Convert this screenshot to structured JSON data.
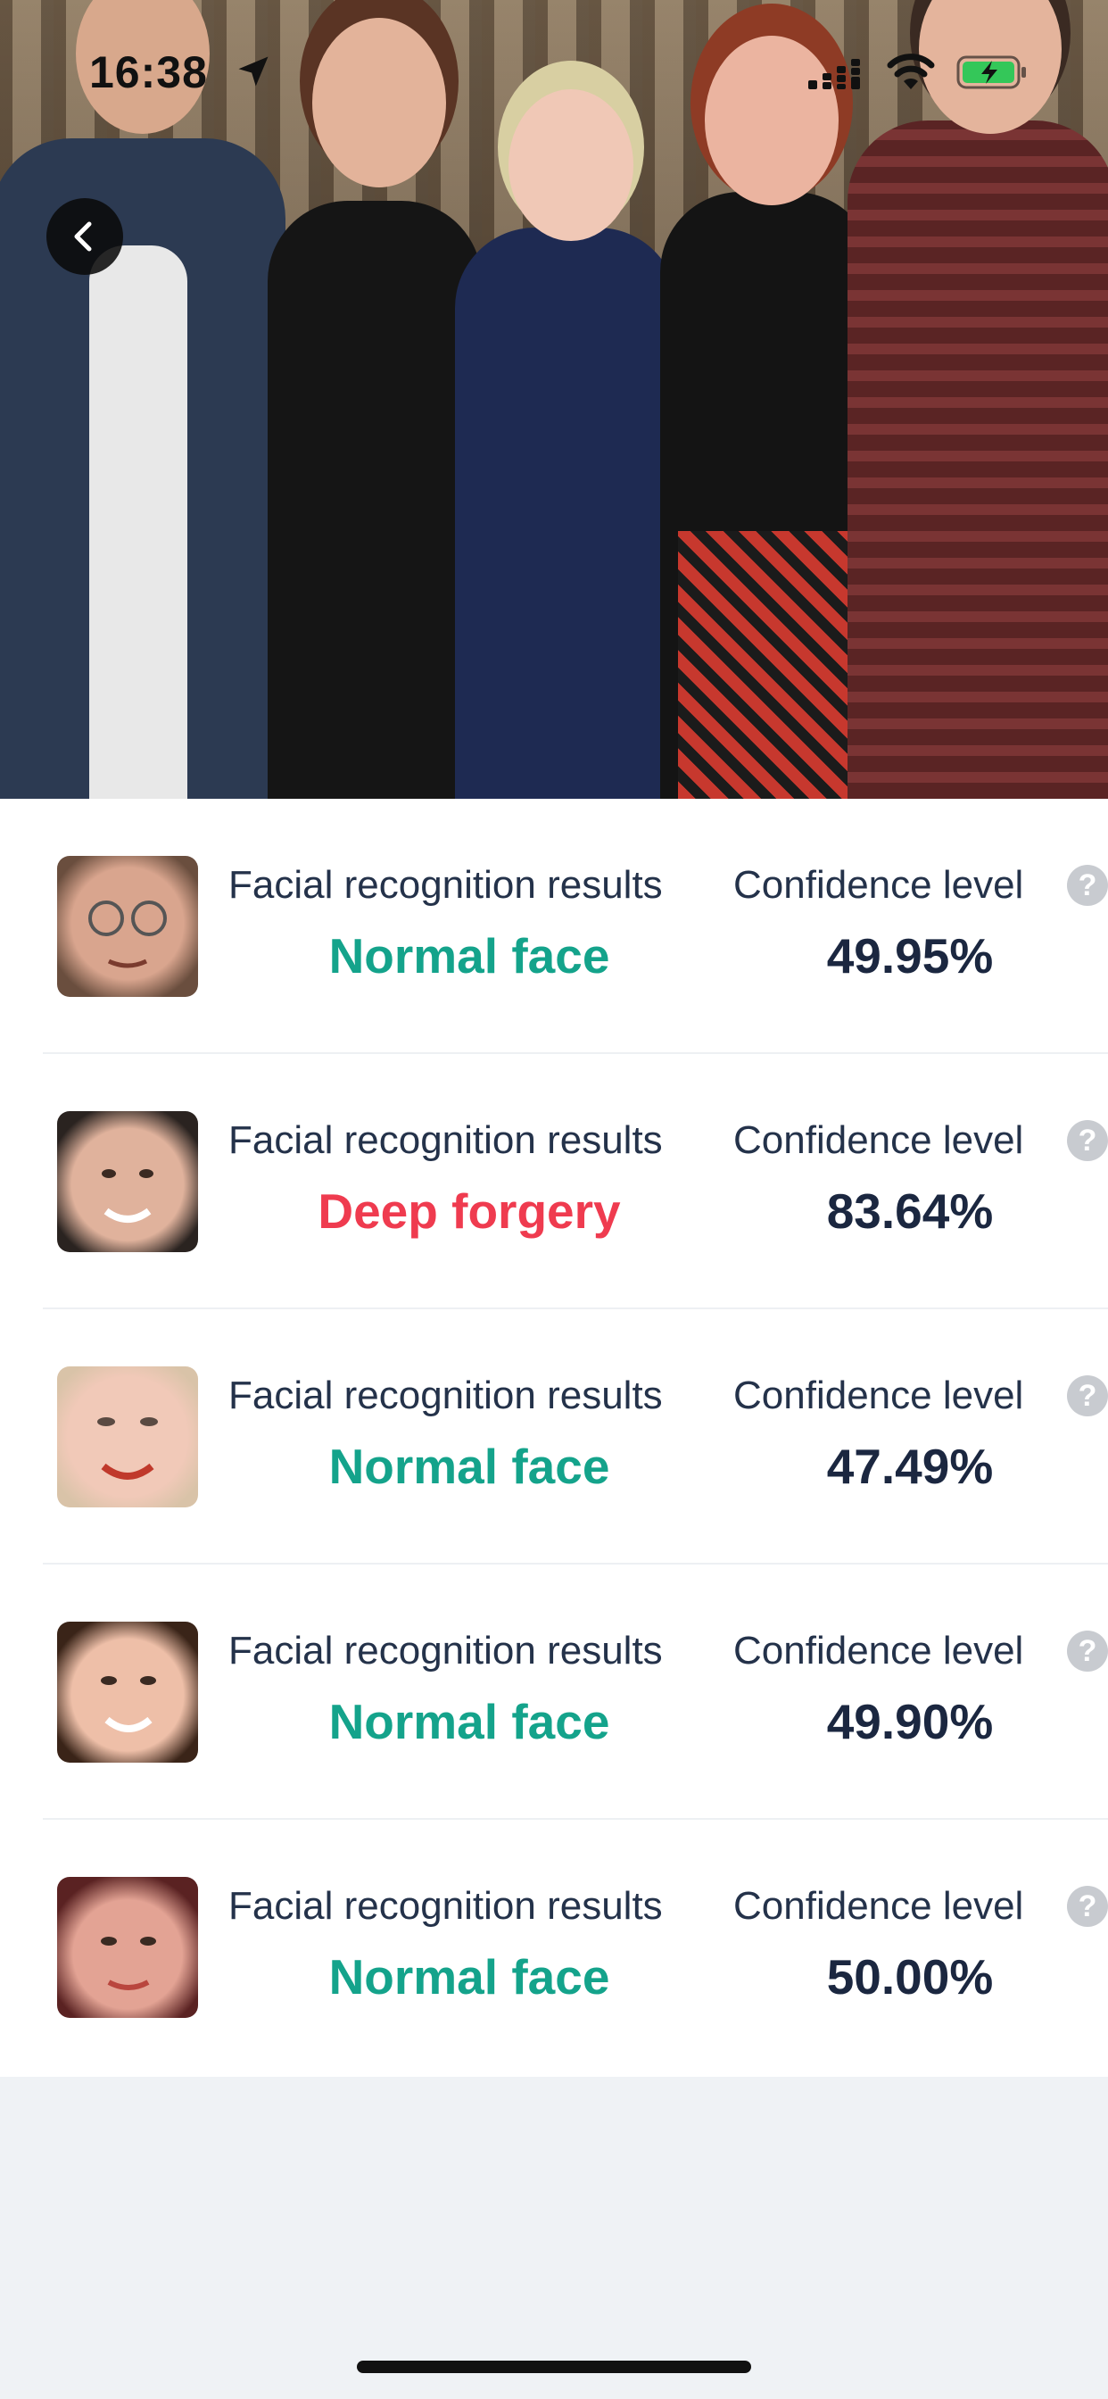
{
  "status_bar": {
    "time": "16:38"
  },
  "results": [
    {
      "result_label": "Facial recognition results",
      "verdict": "Normal face",
      "verdict_color": "#14a38b",
      "confidence_label": "Confidence level",
      "confidence": "49.95%",
      "thumb_skin": "#d9a58e"
    },
    {
      "result_label": "Facial recognition results",
      "verdict": "Deep forgery",
      "verdict_color": "#ef3b4f",
      "confidence_label": "Confidence level",
      "confidence": "83.64%",
      "thumb_skin": "#e0b29c"
    },
    {
      "result_label": "Facial recognition results",
      "verdict": "Normal face",
      "verdict_color": "#14a38b",
      "confidence_label": "Confidence level",
      "confidence": "47.49%",
      "thumb_skin": "#f1c9b8"
    },
    {
      "result_label": "Facial recognition results",
      "verdict": "Normal face",
      "verdict_color": "#14a38b",
      "confidence_label": "Confidence level",
      "confidence": "49.90%",
      "thumb_skin": "#eebfa8"
    },
    {
      "result_label": "Facial recognition results",
      "verdict": "Normal face",
      "verdict_color": "#14a38b",
      "confidence_label": "Confidence level",
      "confidence": "50.00%",
      "thumb_skin": "#e3a394"
    }
  ],
  "colors": {
    "normal": "#14a38b",
    "forgery": "#ef3b4f",
    "battery": "#34c759"
  }
}
